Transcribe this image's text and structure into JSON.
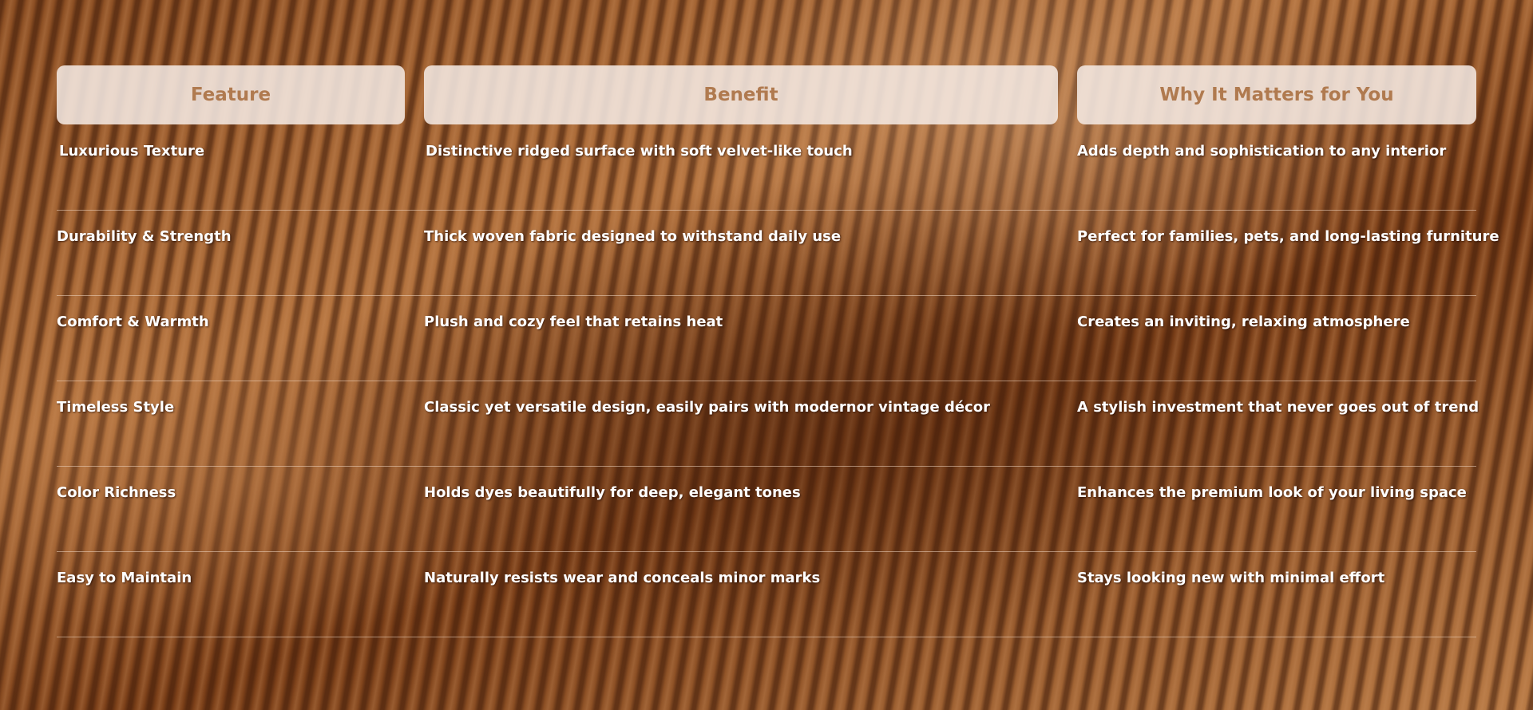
{
  "table": {
    "headers": [
      "Feature",
      "Benefit",
      "Why It Matters for You"
    ],
    "rows": [
      {
        "feature": "Luxurious Texture",
        "benefit": "Distinctive ridged surface with soft velvet-like touch",
        "why": "Adds depth and sophistication to any interior"
      },
      {
        "feature": "Durability & Strength",
        "benefit": "Thick woven fabric designed to withstand daily use",
        "why": "Perfect for families, pets, and long-lasting furniture"
      },
      {
        "feature": "Comfort & Warmth",
        "benefit": "Plush and cozy feel that retains heat",
        "why": "Creates an inviting, relaxing atmosphere"
      },
      {
        "feature": "Timeless Style",
        "benefit": "Classic yet versatile design, easily pairs with modernor vintage décor",
        "why": "A stylish investment that never goes out of trend"
      },
      {
        "feature": "Color Richness",
        "benefit": "Holds dyes beautifully for deep, elegant tones",
        "why": "Enhances the premium look of your living space"
      },
      {
        "feature": "Easy to Maintain",
        "benefit": "Naturally resists wear and conceals minor marks",
        "why": "Stays looking new with minimal effort"
      }
    ]
  },
  "colors": {
    "header_bg": "#f4e8e1",
    "header_text": "#b07a4f",
    "body_text": "#ffffff",
    "background": "#9a5d30"
  },
  "background_image": "brown-corduroy-fabric"
}
